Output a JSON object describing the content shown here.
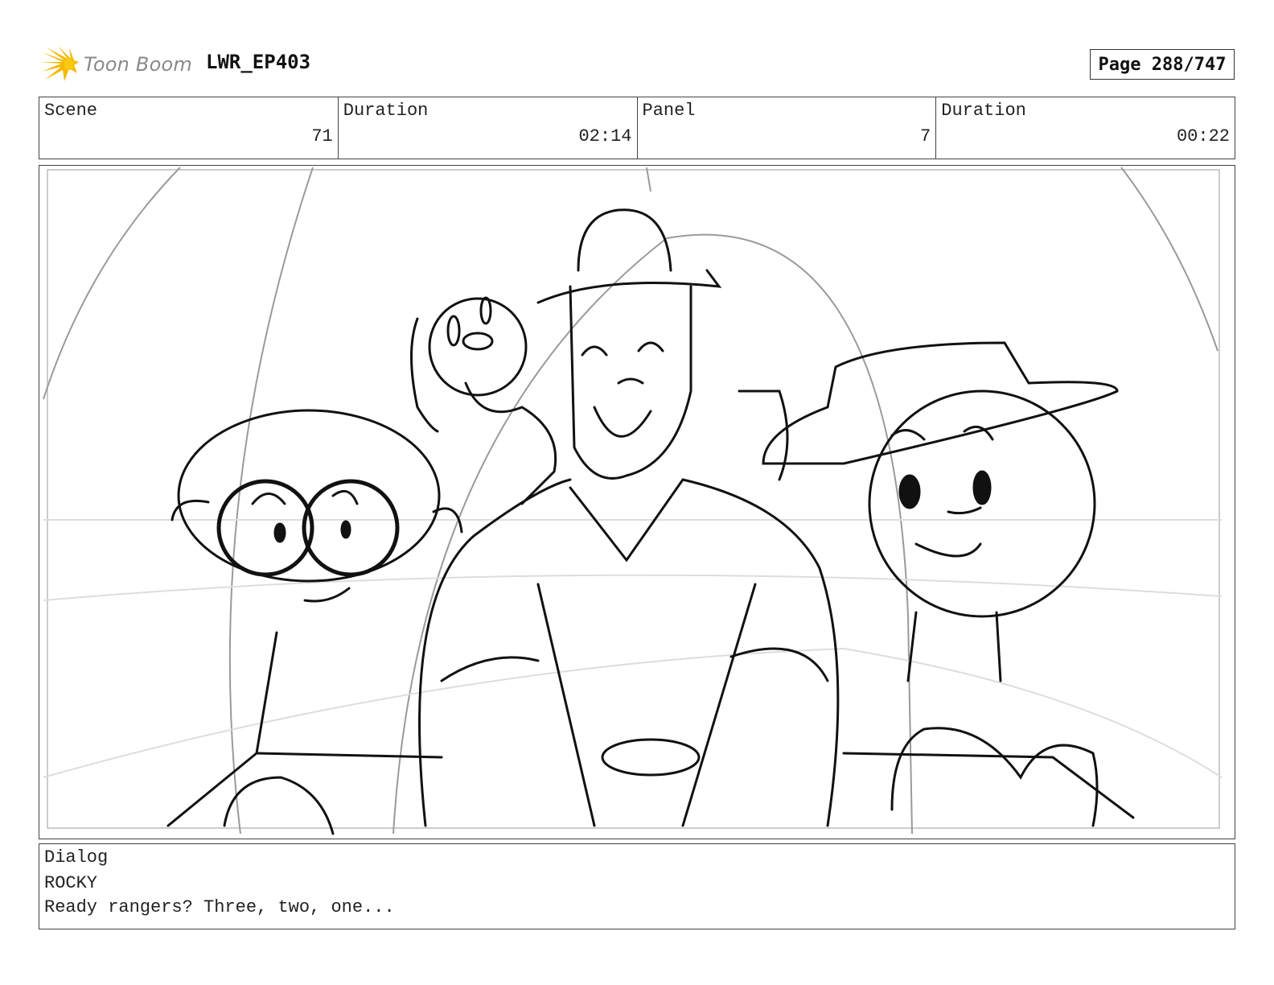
{
  "header": {
    "logo_text": "Toon Boom",
    "project": "LWR_EP403",
    "page": "Page 288/747"
  },
  "info": {
    "scene_label": "Scene",
    "scene_value": "71",
    "scene_duration_label": "Duration",
    "scene_duration_value": "02:14",
    "panel_label": "Panel",
    "panel_value": "7",
    "panel_duration_label": "Duration",
    "panel_duration_value": "00:22"
  },
  "dialog": {
    "label": "Dialog",
    "speaker": "ROCKY",
    "line": "Ready rangers? Three, two, one..."
  },
  "colors": {
    "logo_accent": "#f5b800",
    "sketch_line": "#111111",
    "guide_line": "#9a9a9a"
  }
}
